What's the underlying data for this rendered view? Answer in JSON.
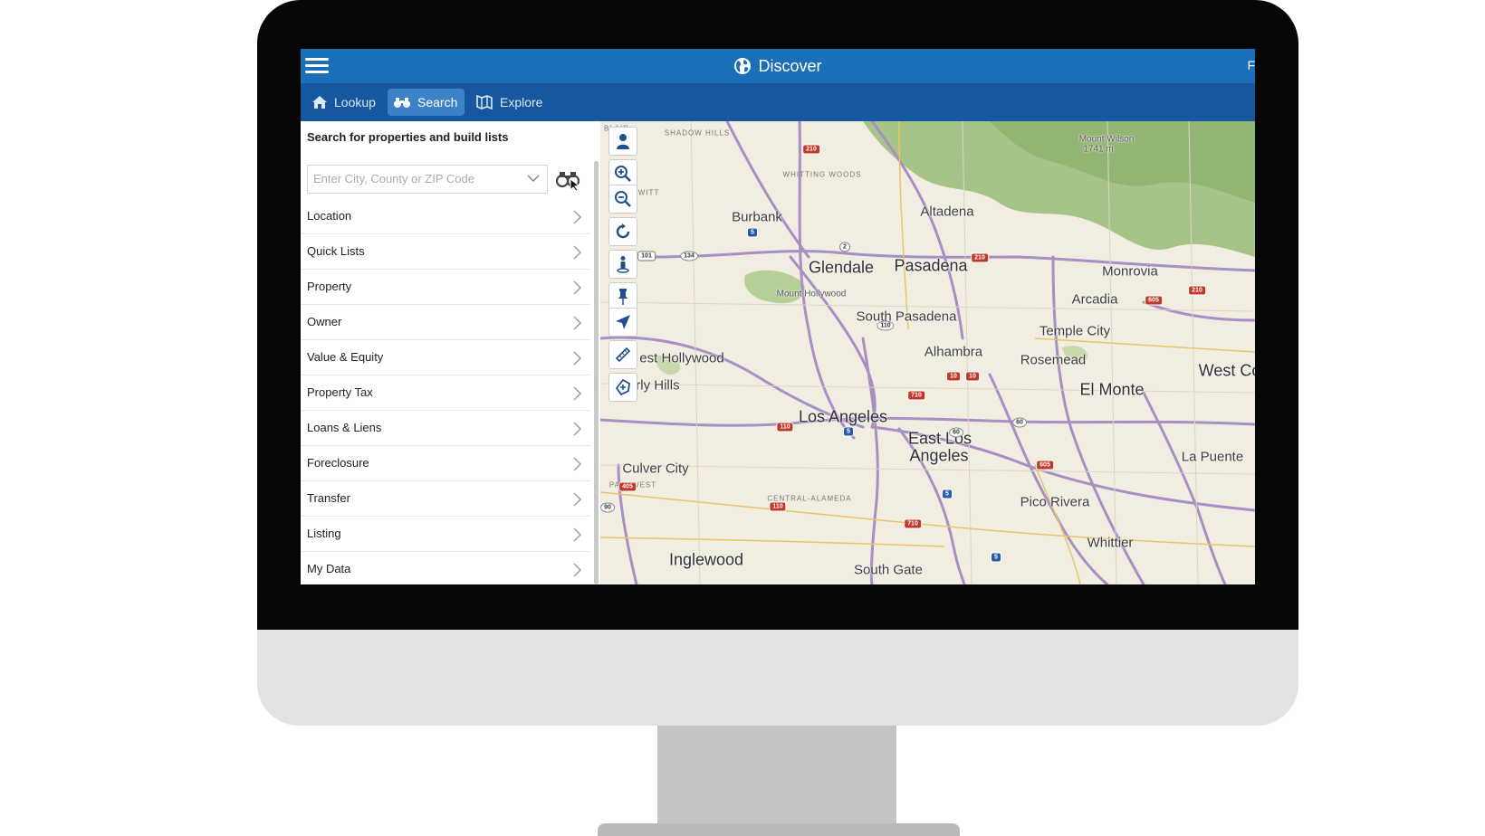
{
  "header": {
    "title": "Discover",
    "edge_text": "F"
  },
  "tabs": [
    {
      "label": "Lookup",
      "icon": "home-icon",
      "active": false
    },
    {
      "label": "Search",
      "icon": "binoculars-icon",
      "active": true
    },
    {
      "label": "Explore",
      "icon": "map-book-icon",
      "active": false
    }
  ],
  "panel": {
    "title": "Search for properties and build lists",
    "location_placeholder": "Enter City, County or ZIP Code",
    "filters": [
      "Location",
      "Quick Lists",
      "Property",
      "Owner",
      "Value & Equity",
      "Property Tax",
      "Loans & Liens",
      "Foreclosure",
      "Transfer",
      "Listing",
      "My Data"
    ]
  },
  "map": {
    "tools": [
      "person-icon",
      "zoom-in-icon",
      "zoom-out-icon",
      "refresh-icon",
      "street-view-icon",
      "pin-icon",
      "navigate-icon",
      "measure-icon",
      "draw-shape-icon"
    ],
    "labels": [
      {
        "text": "Burbank",
        "size": "medium"
      },
      {
        "text": "Altadena",
        "size": "medium"
      },
      {
        "text": "Glendale",
        "size": "large"
      },
      {
        "text": "Pasadena",
        "size": "large"
      },
      {
        "text": "Monrovia",
        "size": "medium"
      },
      {
        "text": "Arcadia",
        "size": "medium"
      },
      {
        "text": "South Pasadena",
        "size": "medium"
      },
      {
        "text": "Temple City",
        "size": "medium"
      },
      {
        "text": "Alhambra",
        "size": "medium"
      },
      {
        "text": "Rosemead",
        "size": "medium"
      },
      {
        "text": "est Hollywood",
        "size": "medium"
      },
      {
        "text": "Be erly Hills",
        "size": "medium"
      },
      {
        "text": "West Co",
        "size": "large"
      },
      {
        "text": "El Monte",
        "size": "large"
      },
      {
        "text": "Los Angeles",
        "size": "large"
      },
      {
        "text": "East Los",
        "size": "large"
      },
      {
        "text": "Angeles",
        "size": "large"
      },
      {
        "text": "La Puente",
        "size": "medium"
      },
      {
        "text": "Culver City",
        "size": "medium"
      },
      {
        "text": "Pico Rivera",
        "size": "medium"
      },
      {
        "text": "Whittier",
        "size": "medium"
      },
      {
        "text": "Inglewood",
        "size": "large"
      },
      {
        "text": "South Gate",
        "size": "medium"
      },
      {
        "text": "Mount Hollywood",
        "size": "small"
      },
      {
        "text": "Mount Wilson",
        "size": "small"
      },
      {
        "text": "1741 m",
        "size": "small"
      },
      {
        "text": "SHADOW HILLS",
        "size": "tiny"
      },
      {
        "text": "WHITTING WOODS",
        "size": "tiny"
      },
      {
        "text": "NSWITT",
        "size": "tiny"
      },
      {
        "text": "BLAIR",
        "size": "tiny"
      },
      {
        "text": "PARKWEST",
        "size": "tiny"
      },
      {
        "text": "CENTRAL-ALAMEDA",
        "size": "tiny"
      }
    ],
    "shields": [
      "210",
      "2",
      "134",
      "101",
      "5",
      "210",
      "605",
      "210",
      "110",
      "10",
      "10",
      "710",
      "110",
      "5",
      "60",
      "60",
      "605",
      "5",
      "405",
      "90",
      "110",
      "710",
      "5"
    ]
  },
  "colors": {
    "header_blue": "#1a6fb8",
    "tab_bar_blue": "#1558a0",
    "active_tab": "#3c82c7",
    "map_land": "#f1ede1",
    "map_roads": "#a98ec4",
    "map_mountains": "#9fbe7e"
  }
}
